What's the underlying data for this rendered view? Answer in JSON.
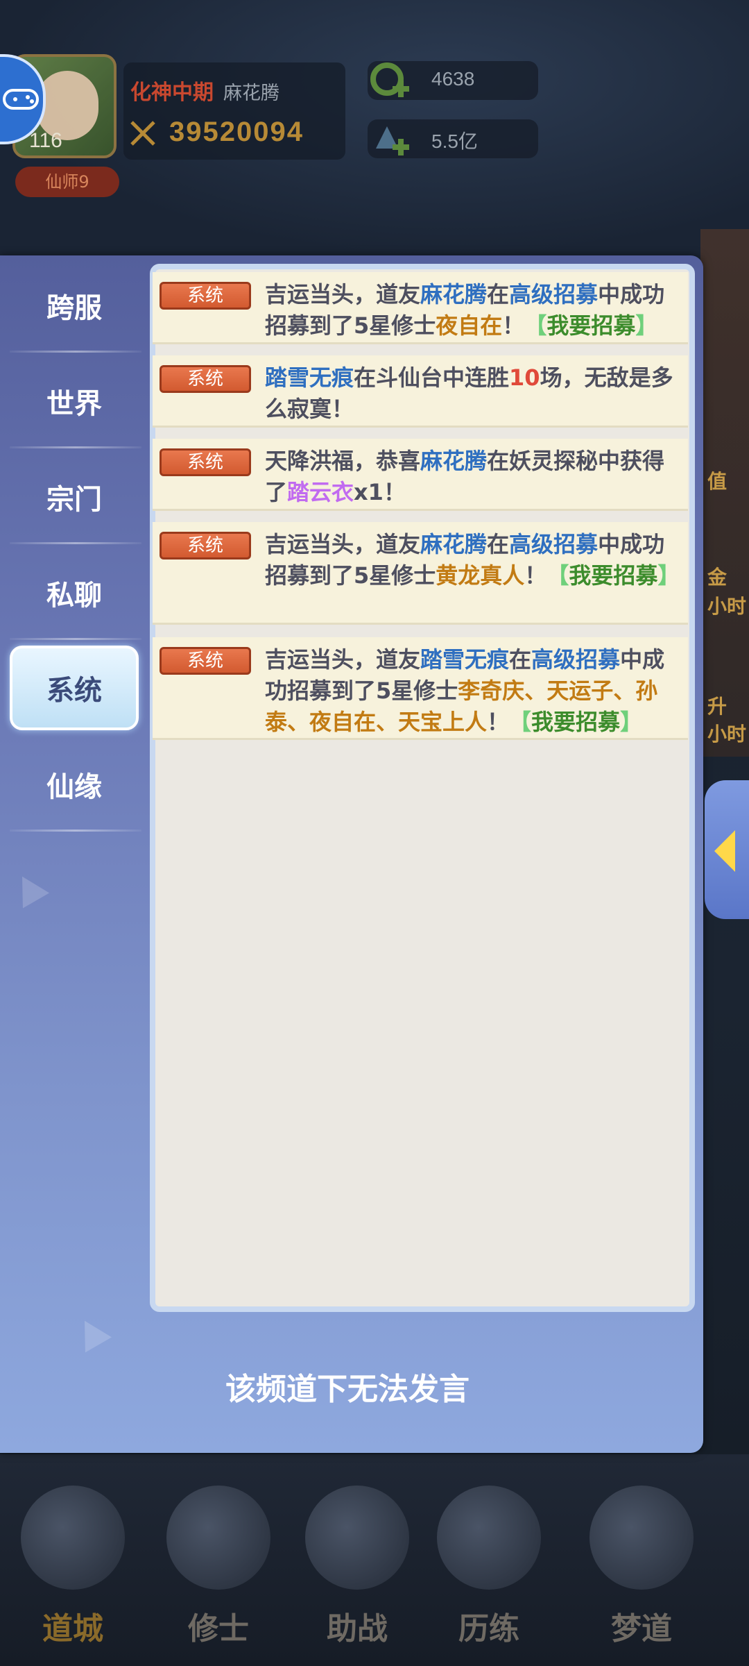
{
  "hud": {
    "level": "116",
    "realm": "化神中期",
    "player_name": "麻花腾",
    "power": "39520094",
    "rank": "仙师9",
    "resource_1": "4638",
    "resource_2": "5.5亿",
    "side_labels": [
      "值",
      "金",
      "小时",
      "升",
      "小时"
    ]
  },
  "channels": [
    "跨服",
    "世界",
    "宗门",
    "私聊",
    "系统",
    "仙缘"
  ],
  "active_channel": "系统",
  "messages": [
    {
      "tag": "系统",
      "parts": [
        {
          "t": "吉运当头，道友",
          "c": ""
        },
        {
          "t": "麻花腾",
          "c": "blue"
        },
        {
          "t": "在",
          "c": ""
        },
        {
          "t": "高级招募",
          "c": "blue"
        },
        {
          "t": "中成功招募到了5星修士",
          "c": ""
        },
        {
          "t": "夜自在",
          "c": "gold"
        },
        {
          "t": "！",
          "c": ""
        },
        {
          "t": "【",
          "c": "lgreen"
        },
        {
          "t": "我要招募",
          "c": "green"
        },
        {
          "t": "】",
          "c": "lgreen"
        }
      ]
    },
    {
      "tag": "系统",
      "parts": [
        {
          "t": "踏雪无痕",
          "c": "blue"
        },
        {
          "t": "在斗仙台中连胜",
          "c": ""
        },
        {
          "t": "10",
          "c": "red"
        },
        {
          "t": "场，无敌是多么寂寞！",
          "c": ""
        }
      ]
    },
    {
      "tag": "系统",
      "parts": [
        {
          "t": "天降洪福，恭喜",
          "c": ""
        },
        {
          "t": "麻花腾",
          "c": "blue"
        },
        {
          "t": "在妖灵探秘中获得了",
          "c": ""
        },
        {
          "t": "踏云衣",
          "c": "purple"
        },
        {
          "t": "x1！",
          "c": ""
        }
      ]
    },
    {
      "tag": "系统",
      "parts": [
        {
          "t": "吉运当头，道友",
          "c": ""
        },
        {
          "t": "麻花腾",
          "c": "blue"
        },
        {
          "t": "在",
          "c": ""
        },
        {
          "t": "高级招募",
          "c": "blue"
        },
        {
          "t": "中成功招募到了5星修士",
          "c": ""
        },
        {
          "t": "黄龙真人",
          "c": "gold"
        },
        {
          "t": "！",
          "c": ""
        },
        {
          "t": "【",
          "c": "lgreen"
        },
        {
          "t": "我要招募",
          "c": "green"
        },
        {
          "t": "】",
          "c": "lgreen"
        }
      ]
    },
    {
      "tag": "系统",
      "parts": [
        {
          "t": "吉运当头，道友",
          "c": ""
        },
        {
          "t": "踏雪无痕",
          "c": "blue"
        },
        {
          "t": "在",
          "c": ""
        },
        {
          "t": "高级招募",
          "c": "blue"
        },
        {
          "t": "中成功招募到了5星修士",
          "c": ""
        },
        {
          "t": "李奇庆、天运子、孙泰、夜自在、天宝上人",
          "c": "gold"
        },
        {
          "t": "！",
          "c": ""
        },
        {
          "t": "【",
          "c": "lgreen"
        },
        {
          "t": "我要招募",
          "c": "green"
        },
        {
          "t": "】",
          "c": "lgreen"
        }
      ]
    }
  ],
  "footer_note": "该频道下无法发言",
  "bottom_nav": [
    "道城",
    "修士",
    "助战",
    "历练",
    "梦道"
  ],
  "colors": {
    "panel_top": "#545f9c",
    "panel_bottom": "#8ea8de",
    "badge": "#e9784e",
    "name_blue": "#2f6fc0",
    "item_gold": "#c27b13",
    "link_green": "#3c8c2c"
  }
}
